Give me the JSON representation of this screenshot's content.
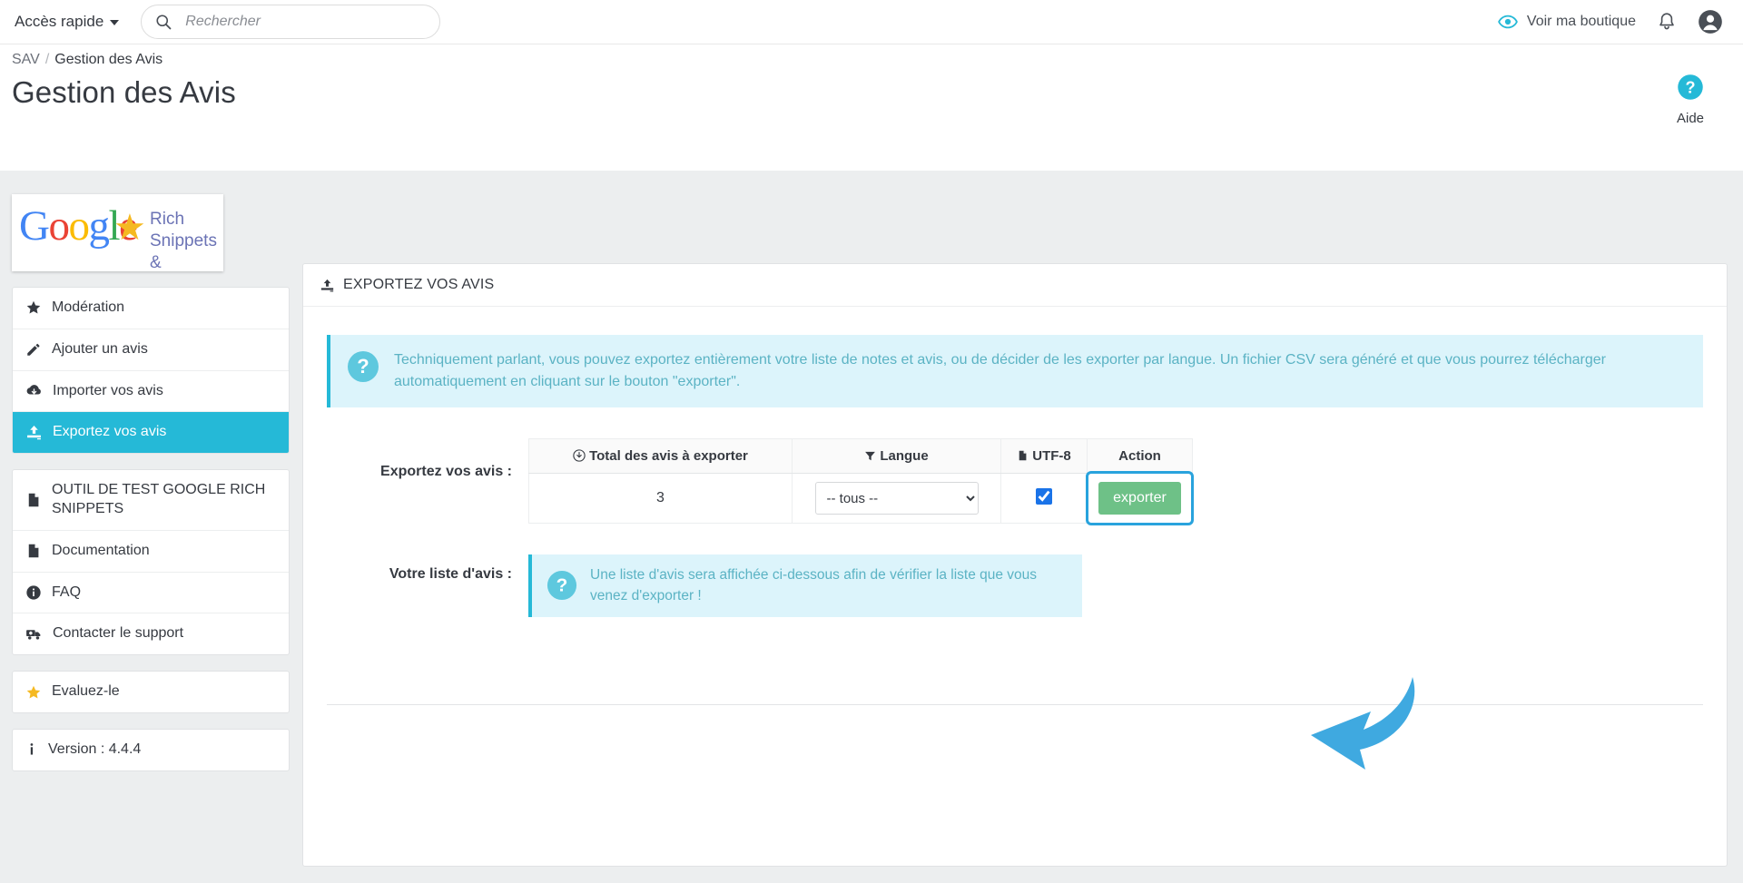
{
  "header": {
    "quick_access_label": "Accès rapide",
    "search_placeholder": "Rechercher",
    "search_value": "",
    "view_shop_label": "Voir ma boutique"
  },
  "breadcrumb": {
    "parent": "SAV",
    "separator": "/",
    "current": "Gestion des Avis"
  },
  "page": {
    "title": "Gestion des Avis",
    "help_label": "Aide"
  },
  "banner": {
    "google_g": "G",
    "google_o1": "o",
    "google_o2": "o",
    "google_g2": "g",
    "google_l": "l",
    "google_e": "e",
    "star": "★",
    "line1": "Rich Snippets",
    "line2": "& Reviews"
  },
  "sidebar": {
    "group1": [
      {
        "label": "Modération",
        "icon": "star-icon",
        "active": false
      },
      {
        "label": "Ajouter un avis",
        "icon": "pencil-icon",
        "active": false
      },
      {
        "label": "Importer vos avis",
        "icon": "cloud-download-icon",
        "active": false
      },
      {
        "label": "Exportez vos avis",
        "icon": "upload-icon",
        "active": true
      }
    ],
    "group2": [
      {
        "label": "OUTIL DE TEST GOOGLE RICH SNIPPETS",
        "icon": "file-icon"
      },
      {
        "label": "Documentation",
        "icon": "file-icon"
      },
      {
        "label": "FAQ",
        "icon": "info-icon"
      },
      {
        "label": "Contacter le support",
        "icon": "support-truck-icon"
      }
    ],
    "rate_label": "Evaluez-le",
    "version_label": "Version : 4.4.4"
  },
  "panel": {
    "header_title": "EXPORTEZ VOS AVIS",
    "info_alert": "Techniquement parlant, vous pouvez exportez entièrement votre liste de notes et avis, ou de décider de les exporter par langue. Un fichier CSV sera généré et que vous pourrez télécharger automatiquement en cliquant sur le bouton \"exporter\".",
    "export_row_label": "Exportez vos avis :",
    "table": {
      "headers": [
        "Total des avis à exporter",
        "Langue",
        "UTF-8",
        "Action"
      ],
      "total_value": "3",
      "language_selected": "-- tous --",
      "language_options": [
        "-- tous --"
      ],
      "utf8_checked": true,
      "export_button_label": "exporter"
    },
    "list_row_label": "Votre liste d'avis :",
    "list_alert": "Une liste d'avis sera affichée ci-dessous afin de vérifier la liste que vous venez d'exporter !"
  },
  "colors": {
    "accent_blue": "#25b9d7",
    "arrow_blue": "#3fa9e0",
    "green_button": "#6ec187",
    "info_bg": "#dcf4fb",
    "info_text": "#5bb3c4"
  }
}
